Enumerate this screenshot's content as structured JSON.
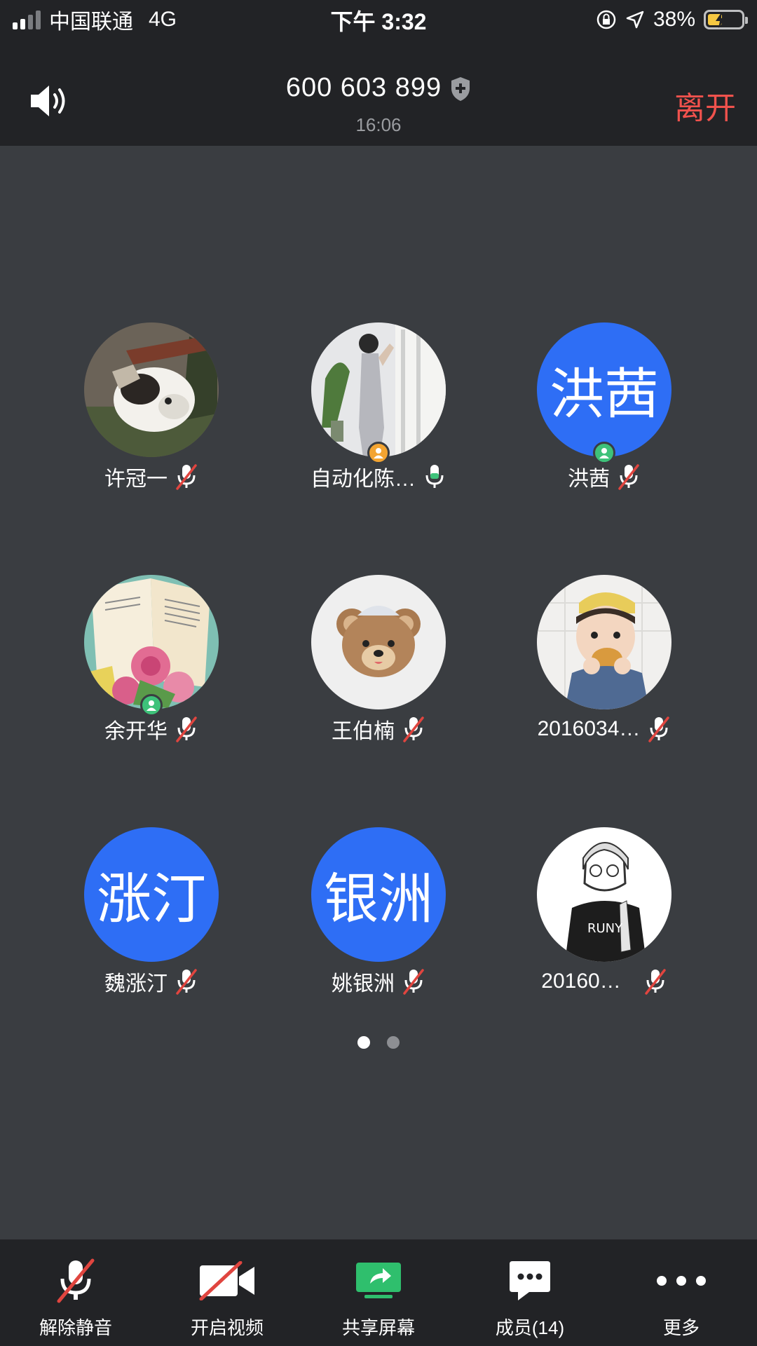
{
  "status_bar": {
    "carrier": "中国联通",
    "network": "4G",
    "time": "下午 3:32",
    "battery": "38%"
  },
  "meeting": {
    "id": "600 603 899",
    "duration": "16:06",
    "leave_label": "离开"
  },
  "participants": [
    {
      "name": "许冠一",
      "avatar_type": "image",
      "avatar_icon": "cat-photo",
      "mic": "muted",
      "badge": null
    },
    {
      "name": "自动化陈…",
      "avatar_type": "image",
      "avatar_icon": "person-photo",
      "mic": "active",
      "badge": "host"
    },
    {
      "name": "洪茜",
      "avatar_type": "text",
      "avatar_text": "洪茜",
      "mic": "muted",
      "badge": "cohost"
    },
    {
      "name": "余开华",
      "avatar_type": "image",
      "avatar_icon": "book-roses-photo",
      "mic": "muted",
      "badge": "cohost"
    },
    {
      "name": "王伯楠",
      "avatar_type": "image",
      "avatar_icon": "bear-photo",
      "mic": "muted",
      "badge": null
    },
    {
      "name": "2016034…",
      "avatar_type": "image",
      "avatar_icon": "child-photo",
      "mic": "muted",
      "badge": null
    },
    {
      "name": "魏涨汀",
      "avatar_type": "text",
      "avatar_text": "涨汀",
      "mic": "muted",
      "badge": null
    },
    {
      "name": "姚银洲",
      "avatar_type": "text",
      "avatar_text": "银洲",
      "mic": "muted",
      "badge": null
    },
    {
      "name": "20160…",
      "avatar_type": "image",
      "avatar_icon": "sketch-person-photo",
      "mic": "muted",
      "badge": null
    }
  ],
  "pager": {
    "pages": 2,
    "current": 1
  },
  "toolbar": {
    "unmute": "解除静音",
    "video": "开启视频",
    "share": "共享屏幕",
    "members": "成员(14)",
    "more": "更多"
  },
  "colors": {
    "background": "#3a3d41",
    "bar": "#222326",
    "leave": "#f0524d",
    "avatar_blue": "#2e6ef5",
    "share_green": "#2fbf6d"
  }
}
